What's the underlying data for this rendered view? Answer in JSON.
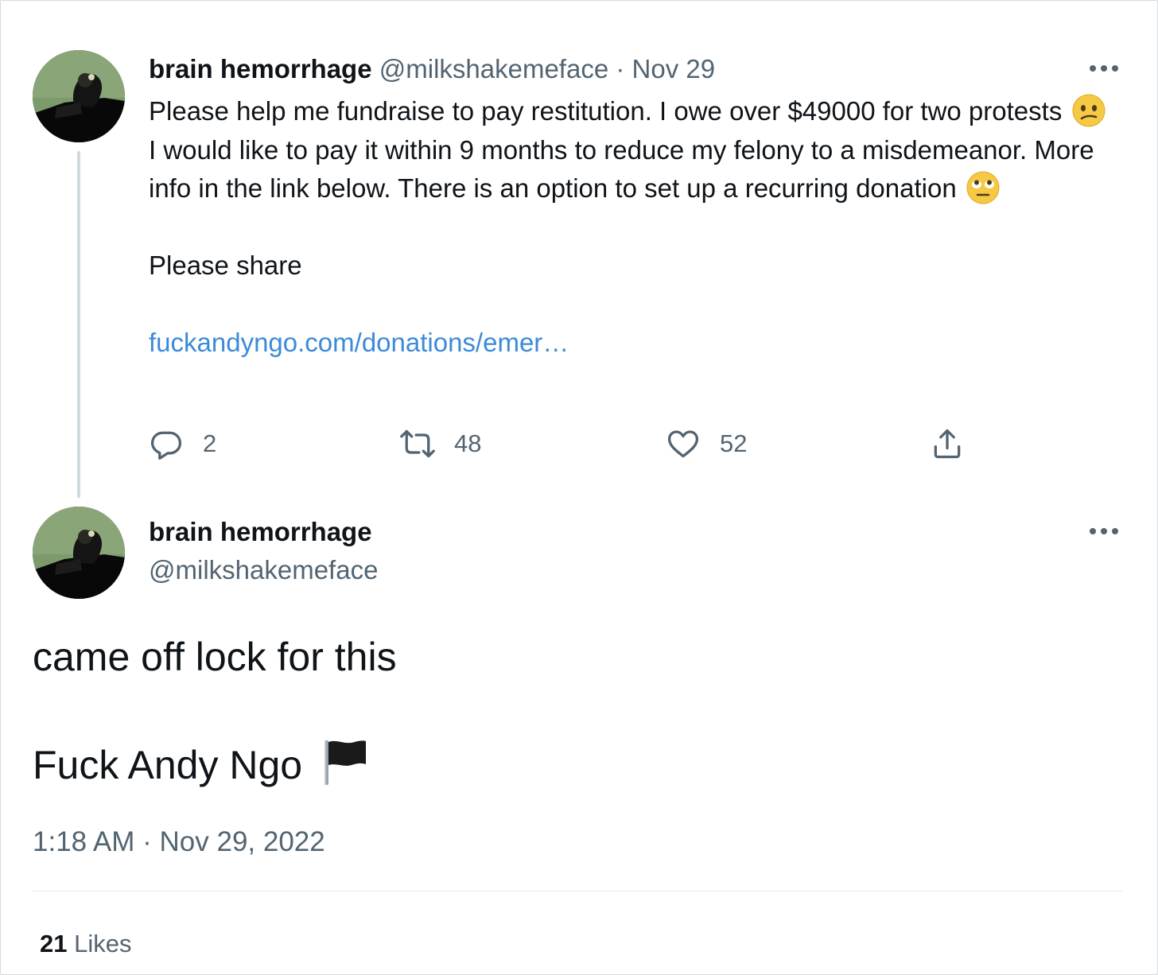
{
  "parent_tweet": {
    "display_name": "brain hemorrhage",
    "handle": "@milkshakemeface",
    "separator": " · ",
    "date": "Nov 29",
    "text_line_1a": "Please help me fundraise to pay restitution. I owe over $49000 for two protests",
    "text_line_1b": "I would like to pay it within 9 months to reduce my felony to a misdemeanor. More info in the link below. There is an option to set up a recurring donation",
    "emoji_1": "confused-face-emoji",
    "emoji_2": "face-with-rolling-eyes-emoji",
    "text_para_2": "Please share",
    "link_text": "fuckandyngo.com/donations/emer…",
    "actions": {
      "reply_count": "2",
      "retweet_count": "48",
      "like_count": "52"
    }
  },
  "main_tweet": {
    "display_name": "brain hemorrhage",
    "handle": "@milkshakemeface",
    "text_line_1": "came off lock for this",
    "text_line_2": "Fuck Andy Ngo",
    "emoji": "black-flag-emoji",
    "timestamp": "1:18 AM · Nov 29, 2022",
    "likes_count": "21",
    "likes_label": "Likes"
  },
  "colors": {
    "text": "#0f1419",
    "muted": "#536471",
    "link": "#3b8bd9",
    "thread_line": "#cfd9de"
  }
}
